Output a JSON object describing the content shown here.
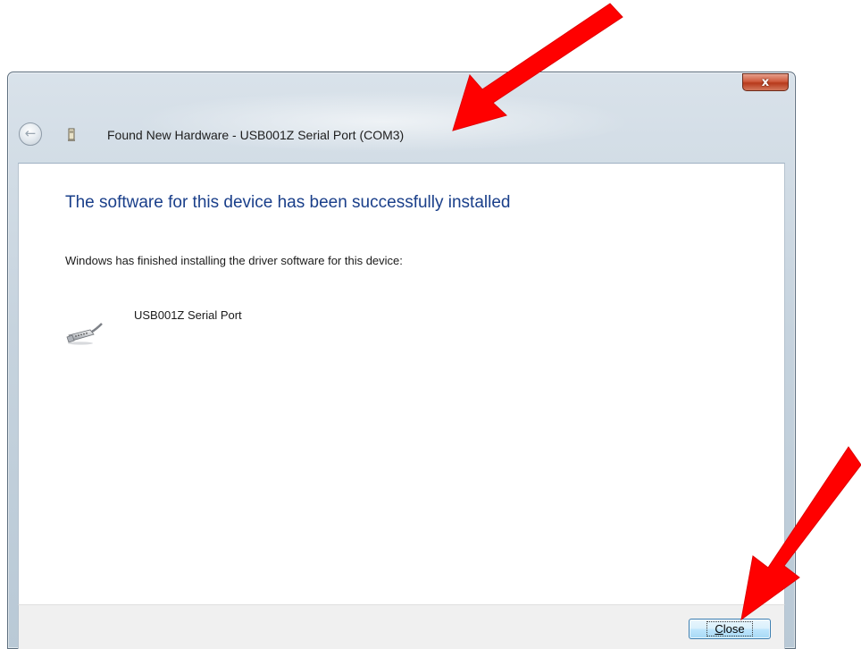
{
  "window": {
    "title": "Found New Hardware - USB001Z Serial Port (COM3)",
    "close_glyph": "x"
  },
  "nav": {
    "back_glyph": "←",
    "back_icon": "back-arrow-icon"
  },
  "content": {
    "heading": "The software for this device has been successfully installed",
    "description": "Windows has finished installing the driver software for this device:",
    "device_name": "USB001Z Serial Port",
    "device_icon": "serial-port-cable-icon"
  },
  "footer": {
    "close_button": {
      "accelerator": "C",
      "rest": "lose"
    }
  },
  "annotations": {
    "arrow_color": "#ff0000"
  },
  "colors": {
    "heading": "#1a3f8a",
    "close_control": "#c8472b",
    "button_border": "#3c7fb1"
  }
}
